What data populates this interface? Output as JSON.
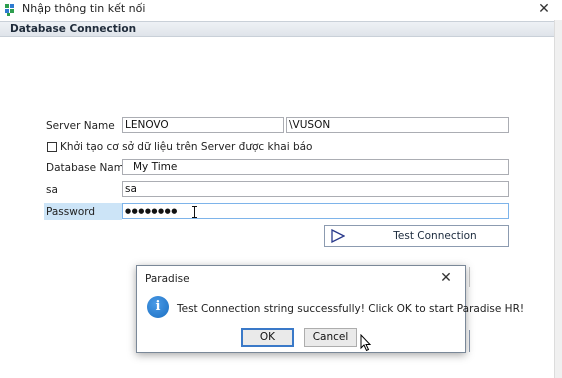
{
  "window": {
    "title": "Nhập thông tin kết nối",
    "close_glyph": "✕",
    "section_header": "Database Connection"
  },
  "form": {
    "server_name_label": "Server Name",
    "server_name_value": "LENOVO",
    "instance_value": "\\VUSON",
    "init_db_checkbox_label": "Khởi tạo cơ sở dữ liệu trên Server được khai báo",
    "init_db_checked": false,
    "database_name_label": "Database Name",
    "database_name_value": "My Time",
    "user_label": "sa",
    "user_value": "sa",
    "password_label": "Password",
    "password_value": "●●●●●●●●",
    "test_button_label": "Test Connection"
  },
  "dialog": {
    "title": "Paradise",
    "close_glyph": "✕",
    "icon": "info-icon",
    "icon_glyph": "i",
    "message": "Test Connection string successfully! Click OK to start Paradise HR!",
    "ok_label": "OK",
    "cancel_label": "Cancel"
  },
  "colors": {
    "accent": "#3a79c8",
    "header_bg": "#e5e9ee",
    "selection": "#cce4f7",
    "info_blue": "#1b6fc2"
  }
}
